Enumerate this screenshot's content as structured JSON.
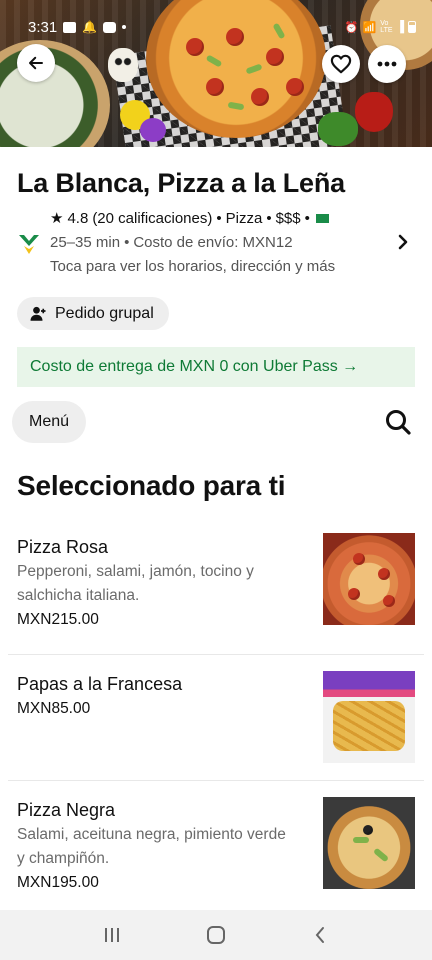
{
  "status_bar": {
    "time": "3:31",
    "signal_label": "Vo LTE"
  },
  "hero": {
    "alt_icon_names": [
      "arrow-left-icon",
      "heart-icon",
      "more-dots-icon"
    ]
  },
  "store": {
    "name": "La Blanca, Pizza a la Leña",
    "rating": "4.8",
    "ratings_count": "(20 calificaciones)",
    "category": "Pizza",
    "price_level": "$$$",
    "delivery_time": "25–35 min",
    "delivery_fee": "Costo de envío: MXN12",
    "more_info": "Toca para ver los horarios, dirección y más"
  },
  "actions": {
    "group_order": "Pedido grupal"
  },
  "promo": {
    "text": "Costo de entrega de MXN 0 con Uber Pass →"
  },
  "menu": {
    "label": "Menú"
  },
  "section": {
    "title": "Seleccionado para ti"
  },
  "items": [
    {
      "name": "Pizza Rosa",
      "desc": "Pepperoni, salami, jamón, tocino y salchicha italiana.",
      "price": "MXN215.00"
    },
    {
      "name": "Papas a la Francesa",
      "desc": "",
      "price": "MXN85.00"
    },
    {
      "name": "Pizza Negra",
      "desc": "Salami, aceituna negra, pimiento verde y champiñón.",
      "price": "MXN195.00"
    }
  ],
  "colors": {
    "promo_text": "#0e7a35",
    "promo_bg": "#e8f5e9",
    "chip_bg": "#eeeeee"
  }
}
